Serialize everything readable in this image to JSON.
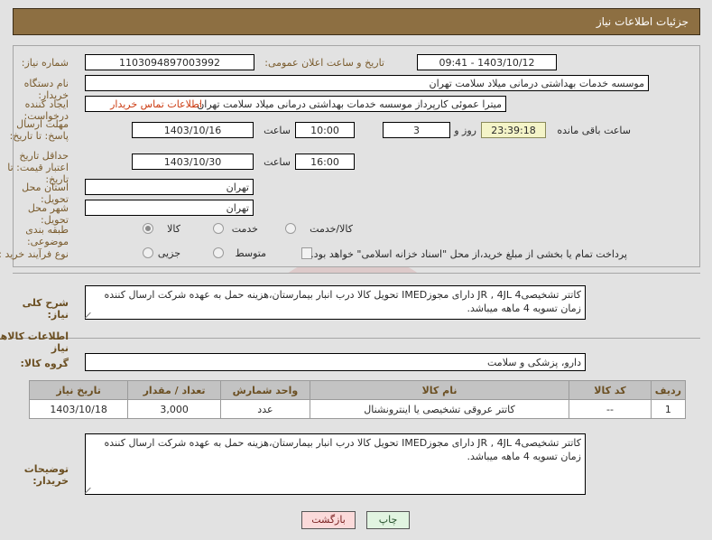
{
  "header": {
    "title": "جزئیات اطلاعات نیاز"
  },
  "form": {
    "need_number": {
      "label": "شماره نیاز:",
      "value": "1103094897003992"
    },
    "announce": {
      "label": "تاریخ و ساعت اعلان عمومی:",
      "value": "1403/10/12 - 09:41"
    },
    "buyer_org": {
      "label": "نام دستگاه خریدار:",
      "value": "موسسه خدمات بهداشتی درمانی میلاد سلامت تهران"
    },
    "requester": {
      "label": "ایجاد کننده درخواست:",
      "value": "میترا عموئی کارپرداز موسسه خدمات بهداشتی درمانی میلاد سلامت تهران"
    },
    "contact_link": "اطلاعات تماس خریدار",
    "reply_deadline": {
      "label": "مهلت ارسال پاسخ: تا تاریخ:",
      "date": "1403/10/16",
      "hour_label": "ساعت",
      "hour": "10:00",
      "days": "3",
      "days_unit": "روز و",
      "countdown": "23:39:18",
      "countdown_suffix": "ساعت باقی مانده"
    },
    "price_validity": {
      "label": "حداقل تاریخ اعتبار قیمت: تا تاریخ:",
      "date": "1403/10/30",
      "hour_label": "ساعت",
      "hour": "16:00"
    },
    "province": {
      "label": "استان محل تحویل:",
      "value": "تهران"
    },
    "city": {
      "label": "شهر محل تحویل:",
      "value": "تهران"
    },
    "subject_class": {
      "label": "طبقه بندی موضوعی:",
      "options": [
        "کالا",
        "خدمت",
        "کالا/خدمت"
      ],
      "selected": "کالا"
    },
    "purchase_type": {
      "label": "نوع فرآیند خرید :",
      "options": [
        "جزیی",
        "متوسط"
      ],
      "selected": "جزیی",
      "checkbox_label": "پرداخت تمام یا بخشی از مبلغ خرید،از محل \"اسناد خزانه اسلامی\" خواهد بود.",
      "checkbox_checked": false
    }
  },
  "description": {
    "label": "شرح کلی نیاز:",
    "value": "کاتتر تشخیصی4 JR , 4JL دارای مجوزIMED تحویل کالا درب انبار بیمارستان،هزینه حمل به عهده شرکت ارسال کننده زمان تسویه 4 ماهه میباشد."
  },
  "items_section": {
    "heading": "اطلاعات کالاهای مورد نیاز",
    "group": {
      "label": "گروه کالا:",
      "value": "دارو، پزشکی و سلامت"
    },
    "table": {
      "columns": [
        "ردیف",
        "کد کالا",
        "نام کالا",
        "واحد شمارش",
        "تعداد / مقدار",
        "تاریخ نیاز"
      ],
      "rows": [
        [
          "1",
          "--",
          "کاتتر عروقی تشخیصی یا اینترونشنال",
          "عدد",
          "3,000",
          "1403/10/18"
        ]
      ]
    }
  },
  "buyer_notes": {
    "label": "توضیحات خریدار:",
    "value": "کاتتر تشخیصی4 JR , 4JL دارای مجوزIMED تحویل کالا درب انبار بیمارستان،هزینه حمل به عهده شرکت ارسال کننده زمان تسویه 4 ماهه میباشد."
  },
  "footer": {
    "print_label": "چاپ",
    "back_label": "بازگشت"
  },
  "watermark": {
    "text": "iranTender.net"
  },
  "colors": {
    "header_bg": "#8d6f42",
    "label_text": "#7a5c2e",
    "link": "#cc3b11",
    "page_bg": "#e2e2e2",
    "countdown_bg": "#f4f4c8",
    "table_header_bg": "#c3c3c3",
    "print_btn_bg": "#e1f4e1",
    "back_btn_bg": "#fbdada"
  }
}
